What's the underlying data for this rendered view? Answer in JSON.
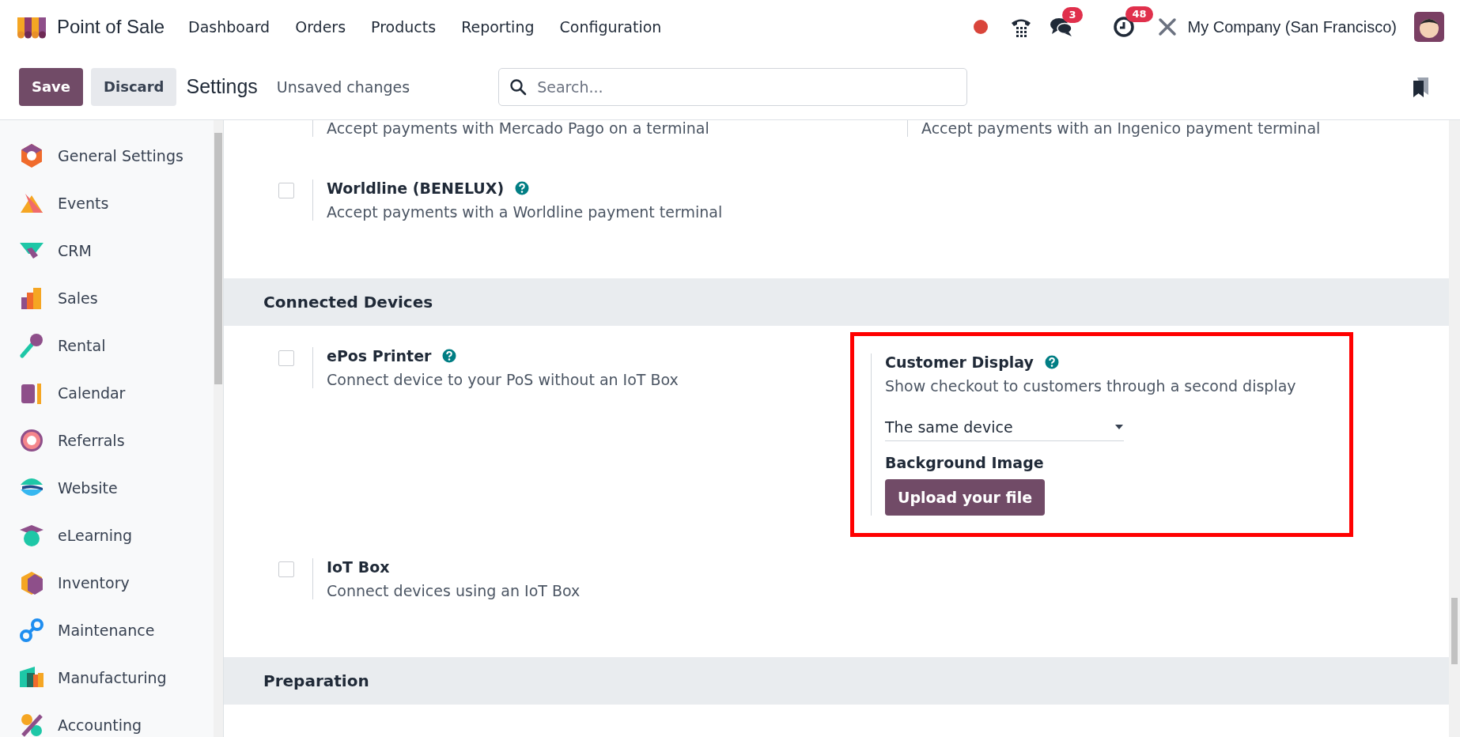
{
  "nav": {
    "app": "Point of Sale",
    "menu": [
      "Dashboard",
      "Orders",
      "Products",
      "Reporting",
      "Configuration"
    ],
    "messages_badge": "3",
    "activities_badge": "48",
    "company": "My Company (San Francisco)"
  },
  "control": {
    "save": "Save",
    "discard": "Discard",
    "title": "Settings",
    "status": "Unsaved changes",
    "search": {
      "placeholder": "Search..."
    }
  },
  "sidebar": {
    "items": [
      "General Settings",
      "Events",
      "CRM",
      "Sales",
      "Rental",
      "Calendar",
      "Referrals",
      "Website",
      "eLearning",
      "Inventory",
      "Maintenance",
      "Manufacturing",
      "Accounting"
    ]
  },
  "content": [
    {
      "kind": "settings",
      "rows": [
        [
          {
            "kind": "plain",
            "description": "Accept payments with Mercado Pago on a terminal",
            "highlighted": false
          },
          {
            "kind": "plain",
            "description": "Accept payments with an Ingenico payment terminal",
            "highlighted": false
          }
        ],
        [
          {
            "kind": "checkbox",
            "checked": false,
            "title": "Worldline (BENELUX)",
            "help": true,
            "description": "Accept payments with a Worldline payment terminal",
            "highlighted": false
          }
        ]
      ]
    },
    {
      "kind": "heading",
      "title": "Connected Devices"
    },
    {
      "kind": "settings",
      "rows": [
        [
          {
            "kind": "checkbox",
            "checked": false,
            "title": "ePos Printer",
            "help": true,
            "description": "Connect device to your PoS without an IoT Box",
            "highlighted": false
          },
          {
            "kind": "plain",
            "title": "Customer Display",
            "help": true,
            "description": "Show checkout to customers through a second display",
            "select": "The same device",
            "subtitle": "Background Image",
            "button": "Upload your file",
            "highlighted": true
          }
        ],
        [
          {
            "kind": "checkbox",
            "checked": false,
            "title": "IoT Box",
            "help": false,
            "description": "Connect devices using an IoT Box",
            "highlighted": false
          }
        ]
      ]
    },
    {
      "kind": "heading",
      "title": "Preparation"
    }
  ]
}
